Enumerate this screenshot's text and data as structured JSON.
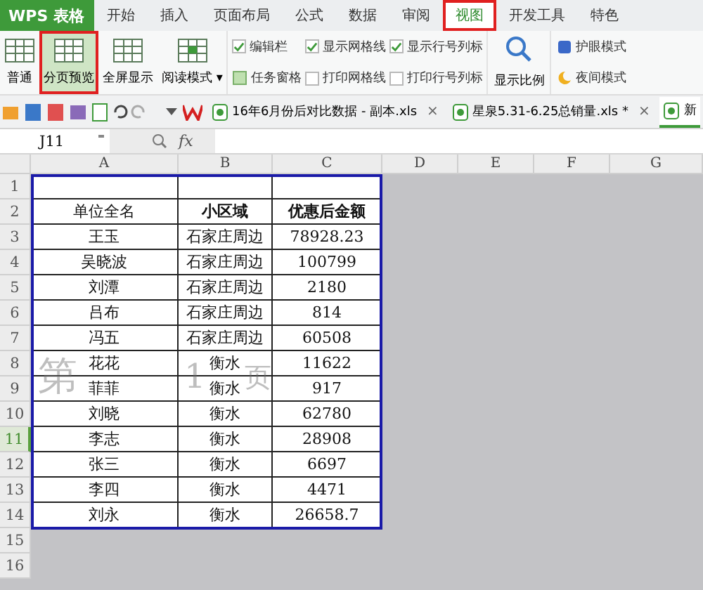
{
  "app": {
    "title": "WPS 表格"
  },
  "menu_tabs": [
    {
      "label": "开始",
      "selected": false
    },
    {
      "label": "插入",
      "selected": false
    },
    {
      "label": "页面布局",
      "selected": false
    },
    {
      "label": "公式",
      "selected": false
    },
    {
      "label": "数据",
      "selected": false
    },
    {
      "label": "审阅",
      "selected": false
    },
    {
      "label": "视图",
      "selected": true
    },
    {
      "label": "开发工具",
      "selected": false
    },
    {
      "label": "特色",
      "selected": false
    }
  ],
  "ribbon": {
    "views": [
      {
        "label": "普通",
        "selected": false
      },
      {
        "label": "分页预览",
        "selected": true
      },
      {
        "label": "全屏显示",
        "selected": false
      },
      {
        "label": "阅读模式",
        "selected": false,
        "dropdown": "▾"
      }
    ],
    "options": [
      {
        "kind": "checkbox",
        "label": "编辑栏",
        "checked": true
      },
      {
        "kind": "pane",
        "label": "任务窗格"
      },
      {
        "kind": "checkbox",
        "label": "显示网格线",
        "checked": true
      },
      {
        "kind": "checkbox",
        "label": "打印网格线",
        "checked": false
      },
      {
        "kind": "checkbox",
        "label": "显示行号列标",
        "checked": true
      },
      {
        "kind": "checkbox",
        "label": "打印行号列标",
        "checked": false
      }
    ],
    "zoom": {
      "label": "显示比例"
    },
    "modes": [
      {
        "kind": "eye",
        "label": "护眼模式"
      },
      {
        "kind": "night",
        "label": "夜间模式"
      }
    ]
  },
  "doc_tabs": [
    {
      "label": "16年6月份后对比数据 - 副本.xls",
      "close": "×",
      "selected": false
    },
    {
      "label": "星泉5.31-6.25总销量.xls *",
      "close": "×",
      "selected": false
    },
    {
      "label": "新",
      "selected": true
    }
  ],
  "formula_bar": {
    "name_box": "J11",
    "fx": "fx"
  },
  "sheet": {
    "columns": [
      {
        "label": "A"
      },
      {
        "label": "B"
      },
      {
        "label": "C"
      },
      {
        "label": "D"
      },
      {
        "label": "E"
      },
      {
        "label": "F"
      },
      {
        "label": "G"
      }
    ],
    "row_numbers": [
      {
        "label": "1",
        "selected": false
      },
      {
        "label": "2",
        "selected": false
      },
      {
        "label": "3",
        "selected": false
      },
      {
        "label": "4",
        "selected": false
      },
      {
        "label": "5",
        "selected": false
      },
      {
        "label": "6",
        "selected": false
      },
      {
        "label": "7",
        "selected": false
      },
      {
        "label": "8",
        "selected": false
      },
      {
        "label": "9",
        "selected": false
      },
      {
        "label": "10",
        "selected": false
      },
      {
        "label": "11",
        "selected": true
      },
      {
        "label": "12",
        "selected": false
      },
      {
        "label": "13",
        "selected": false
      },
      {
        "label": "14",
        "selected": false
      },
      {
        "label": "15",
        "selected": false
      },
      {
        "label": "16",
        "selected": false
      }
    ],
    "header": [
      {
        "text": "单位全名",
        "bold": false
      },
      {
        "text": "小区域",
        "bold": true
      },
      {
        "text": "优惠后金额",
        "bold": true
      }
    ],
    "rows": [
      [
        "王玉",
        "石家庄周边",
        "78928.23"
      ],
      [
        "吴晓波",
        "石家庄周边",
        "100799"
      ],
      [
        "刘潭",
        "石家庄周边",
        "2180"
      ],
      [
        "吕布",
        "石家庄周边",
        "814"
      ],
      [
        "冯五",
        "石家庄周边",
        "60508"
      ],
      [
        "花花",
        "衡水",
        "11622"
      ],
      [
        "菲菲",
        "衡水",
        "917"
      ],
      [
        "刘晓",
        "衡水",
        "62780"
      ],
      [
        "李志",
        "衡水",
        "28908"
      ],
      [
        "张三",
        "衡水",
        "6697"
      ],
      [
        "李四",
        "衡水",
        "4471"
      ],
      [
        "刘永",
        "衡水",
        "26658.7"
      ]
    ],
    "page_label": [
      "第",
      "1",
      "页"
    ]
  }
}
